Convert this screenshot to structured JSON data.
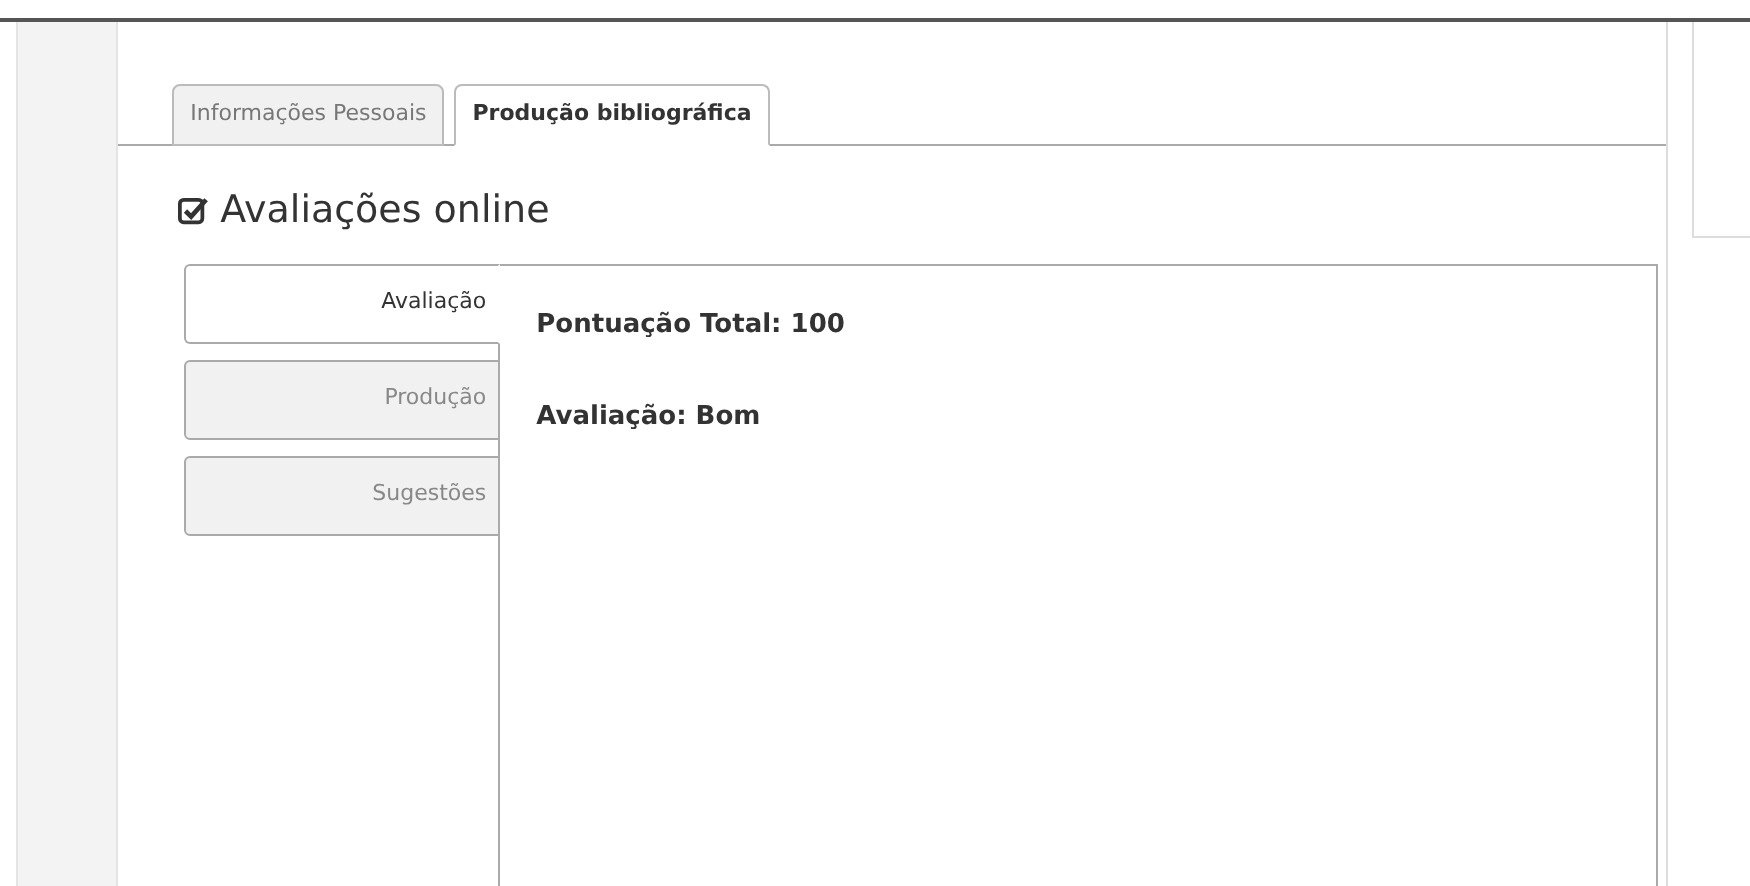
{
  "tabs": [
    {
      "label": "Informações Pessoais",
      "selected": false
    },
    {
      "label": "Produção bibliográfica",
      "selected": true
    }
  ],
  "heading": "Avaliações online",
  "side_tabs": [
    {
      "label": "Avaliação",
      "selected": true
    },
    {
      "label": "Produção",
      "selected": false
    },
    {
      "label": "Sugestões",
      "selected": false
    }
  ],
  "content": [
    "Pontuação Total: 100",
    "Avaliação: Bom"
  ]
}
